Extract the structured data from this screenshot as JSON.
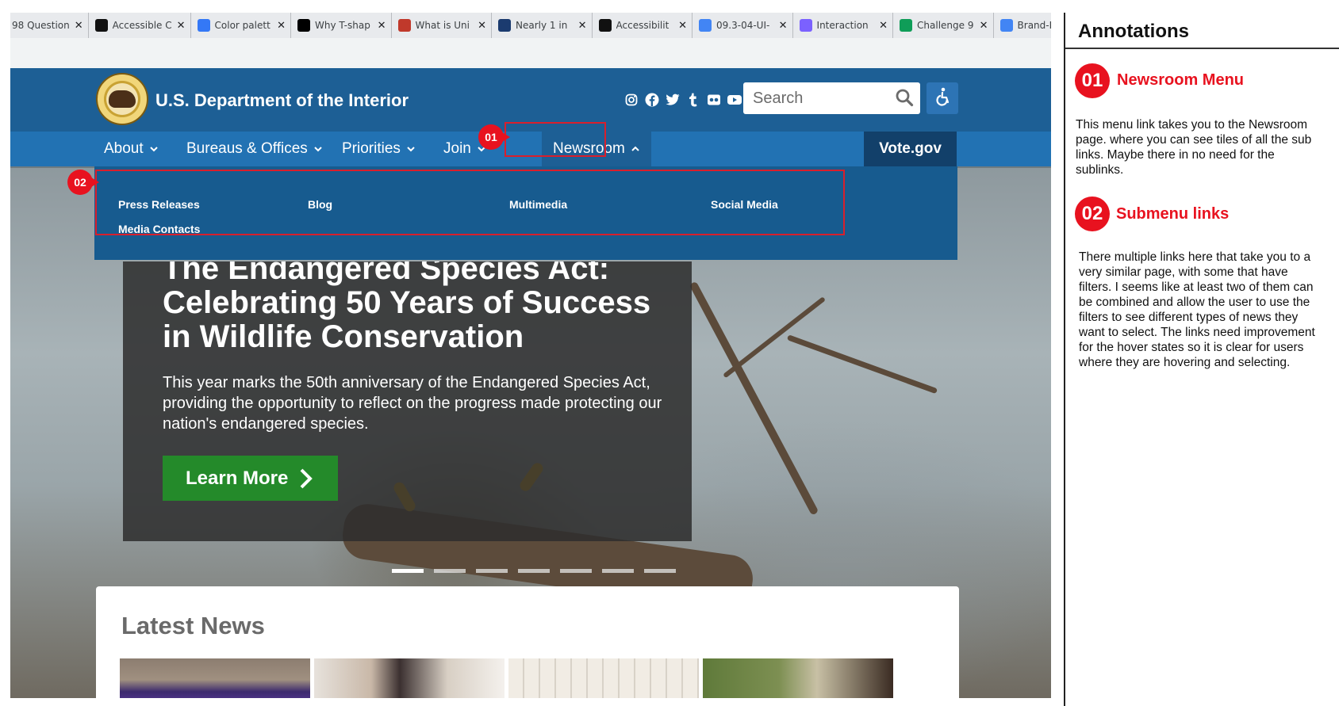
{
  "browser": {
    "tabs": [
      {
        "title": "98 Question",
        "icon": "ask-logo-icon",
        "color": "#6c6c6c"
      },
      {
        "title": "Accessible C",
        "icon": "accessible-colors-icon",
        "color": "#111111"
      },
      {
        "title": "Color palett",
        "icon": "coolors-icon",
        "color": "#3478f6"
      },
      {
        "title": "Why T-shap",
        "icon": "medium-icon",
        "color": "#000000"
      },
      {
        "title": "What is Uni",
        "icon": "ida-icon",
        "color": "#c0392b"
      },
      {
        "title": "Nearly 1 in",
        "icon": "cb-icon",
        "color": "#1b3b6f"
      },
      {
        "title": "Accessibilit",
        "icon": "accessibility-site-icon",
        "color": "#111111"
      },
      {
        "title": "09.3-04-UI-",
        "icon": "google-docs-icon",
        "color": "#4285f4"
      },
      {
        "title": "Interaction",
        "icon": "figma-icon",
        "color": "#7b61ff"
      },
      {
        "title": "Challenge 9",
        "icon": "google-drive-icon",
        "color": "#0f9d58"
      },
      {
        "title": "Brand-Pi",
        "icon": "google-docs-icon",
        "color": "#4285f4"
      }
    ]
  },
  "site": {
    "agency_name": "U.S. Department of the Interior",
    "search_placeholder": "Search",
    "social": [
      "instagram-icon",
      "facebook-icon",
      "twitter-icon",
      "tumblr-icon",
      "flickr-icon",
      "youtube-icon"
    ],
    "nav": [
      {
        "label": "About"
      },
      {
        "label": "Bureaus & Offices"
      },
      {
        "label": "Priorities"
      },
      {
        "label": "Join"
      },
      {
        "label": "Newsroom"
      }
    ],
    "vote_label": "Vote.gov",
    "submenu": [
      "Press Releases",
      "Blog",
      "Multimedia",
      "Social Media",
      "Media Contacts"
    ],
    "hero": {
      "title": "The Endangered Species Act: Celebrating 50 Years of Success in Wildlife Conservation",
      "text": "This year marks the 50th anniversary of the Endangered Species Act, providing the opportunity to reflect on the progress made protecting our nation's endangered species.",
      "button": "Learn More",
      "slide_count": 7,
      "active_slide": 1
    },
    "news_heading": "Latest News"
  },
  "markers": [
    "01",
    "02"
  ],
  "annotations": {
    "title": "Annotations",
    "items": [
      {
        "num": "01",
        "heading": "Newsroom Menu",
        "body": "This menu link takes you to the Newsroom page. where you can see tiles of all the sub links. Maybe there in no need for the sublinks."
      },
      {
        "num": "02",
        "heading": "Submenu links",
        "body": "There multiple links here that take you to a very similar page, with some that have filters. I seems like at least two of them can be combined and allow the user to use the filters to see different types of news they want to select. The links need improvement for the hover states so it is clear for users where they are hovering and selecting."
      }
    ]
  },
  "colors": {
    "header": "#1d5f95",
    "nav": "#2272b3",
    "vote": "#12406a",
    "cta_green": "#248a2a",
    "annotation_red": "#e8121f"
  }
}
